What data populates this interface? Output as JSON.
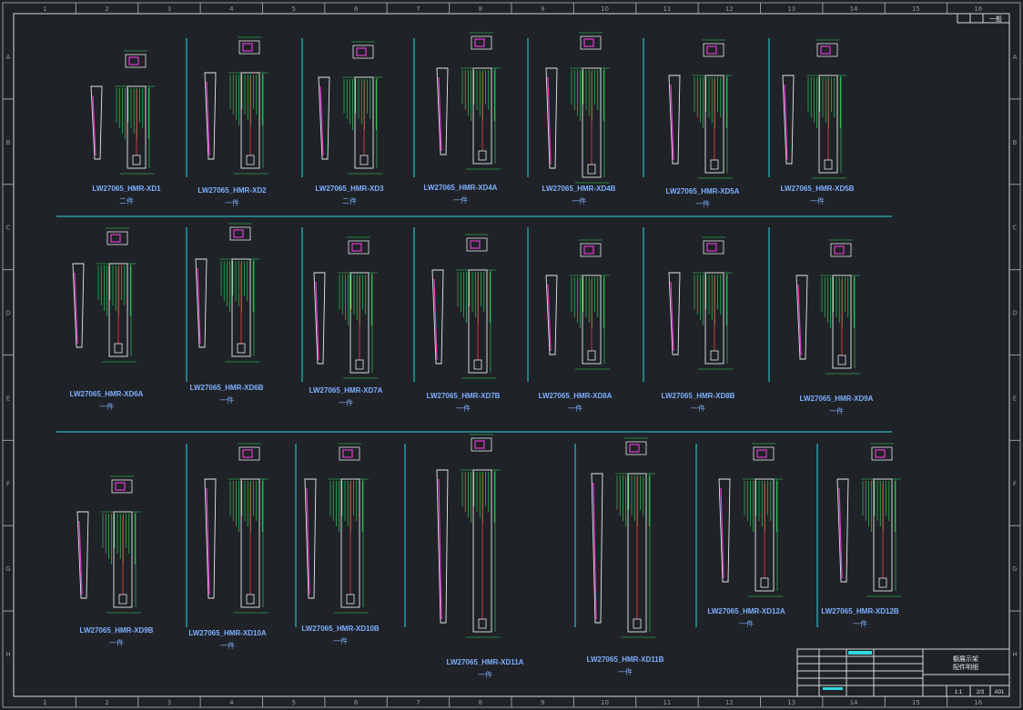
{
  "app": {
    "title": "CAD drawing sheet"
  },
  "top_right_box": "一般",
  "grid": {
    "columns": [
      "1",
      "2",
      "3",
      "4",
      "5",
      "6",
      "7",
      "8",
      "9",
      "10",
      "11",
      "12",
      "13",
      "14",
      "15",
      "16"
    ],
    "rows": [
      "A",
      "B",
      "C",
      "D",
      "E",
      "F",
      "G",
      "H"
    ]
  },
  "parts": [
    {
      "name": "LW27065_HMR-XD1",
      "qty": "二件"
    },
    {
      "name": "LW27065_HMR-XD2",
      "qty": "一件"
    },
    {
      "name": "LW27065_HMR-XD3",
      "qty": "二件"
    },
    {
      "name": "LW27065_HMR-XD4A",
      "qty": "一件"
    },
    {
      "name": "LW27065_HMR-XD4B",
      "qty": "一件"
    },
    {
      "name": "LW27065_HMR-XD5A",
      "qty": "一件"
    },
    {
      "name": "LW27065_HMR-XD5B",
      "qty": "一件"
    },
    {
      "name": "LW27065_HMR-XD6A",
      "qty": "一件"
    },
    {
      "name": "LW27065_HMR-XD6B",
      "qty": "一件"
    },
    {
      "name": "LW27065_HMR-XD7A",
      "qty": "一件"
    },
    {
      "name": "LW27065_HMR-XD7B",
      "qty": "一件"
    },
    {
      "name": "LW27065_HMR-XD8A",
      "qty": "一件"
    },
    {
      "name": "LW27065_HMR-XD8B",
      "qty": "一件"
    },
    {
      "name": "LW27065_HMR-XD9A",
      "qty": "一件"
    },
    {
      "name": "LW27065_HMR-XD9B",
      "qty": "一件"
    },
    {
      "name": "LW27065_HMR-XD10A",
      "qty": "一件"
    },
    {
      "name": "LW27065_HMR-XD10B",
      "qty": "一件"
    },
    {
      "name": "LW27065_HMR-XD11A",
      "qty": "一件"
    },
    {
      "name": "LW27065_HMR-XD11B",
      "qty": "一件"
    },
    {
      "name": "LW27065_HMR-XD12A",
      "qty": "一件"
    },
    {
      "name": "LW27065_HMR-XD12B",
      "qty": "一件"
    }
  ],
  "title_block": {
    "title_line1": "橱展示架",
    "title_line2": "配件明细",
    "scale": "1:1",
    "page": "2/3",
    "size": "A01"
  },
  "colors": {
    "background": "#1f2227",
    "frame": "#d8d8d8",
    "profile": "#e8e8e8",
    "dimension": "#33e05a",
    "label": "#7fb0ff",
    "accent": "#e33bd0",
    "centerline": "#ff3b3b",
    "separator": "#2fd8e0"
  }
}
